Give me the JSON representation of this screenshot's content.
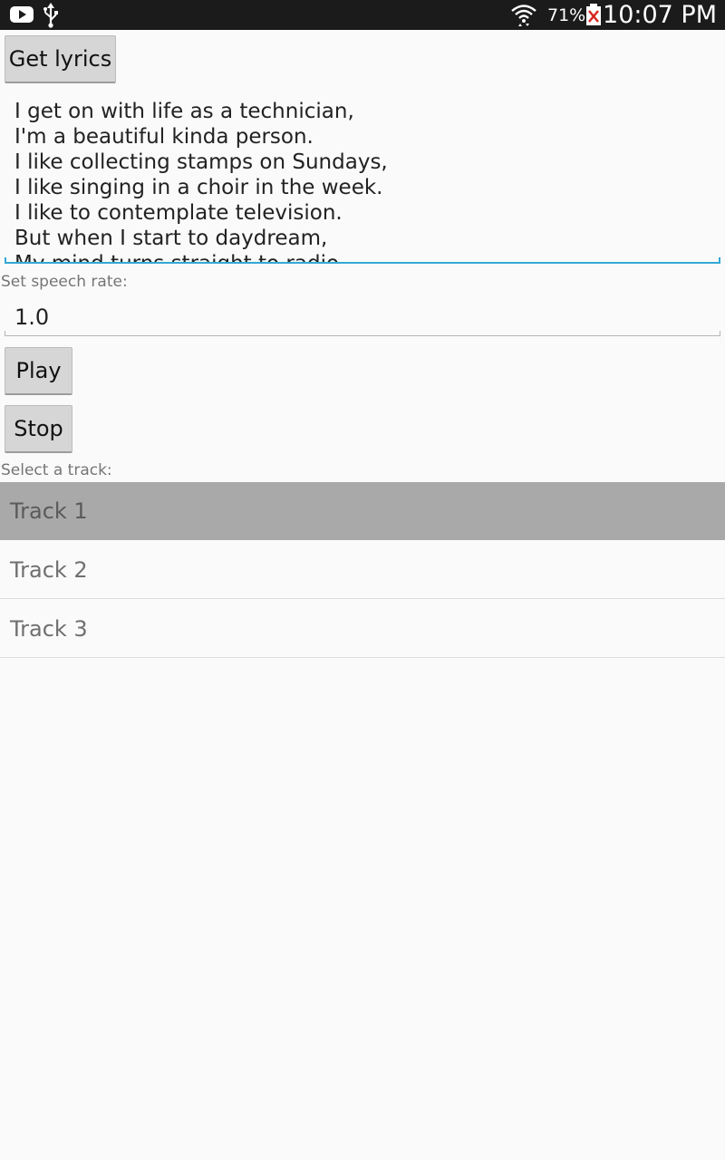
{
  "status_bar": {
    "icons_left": [
      "youtube-icon",
      "usb-icon"
    ],
    "icons_right": [
      "wifi-icon",
      "battery-icon"
    ],
    "battery_percent": "71%",
    "time": "10:07 PM"
  },
  "buttons": {
    "get_lyrics": "Get lyrics",
    "play": "Play",
    "stop": "Stop"
  },
  "lyrics": {
    "text": "I get on with life as a technician,\nI'm a beautiful kinda person.\nI like collecting stamps on Sundays,\nI like singing in a choir in the week.\nI like to contemplate television.\nBut when I start to daydream,\nMy mind turns straight to radio"
  },
  "speech_rate": {
    "label": "Set speech rate:",
    "value": "1.0"
  },
  "track_select": {
    "label": "Select a track:",
    "items": [
      "Track 1",
      "Track 2",
      "Track 3"
    ],
    "selected_index": 0
  },
  "colors": {
    "status_bar": "#1b1b1b",
    "background": "#fafafa",
    "focus_underline": "#33a8d6",
    "selected_row": "#a9a9a9",
    "button": "#d6d6d6"
  }
}
